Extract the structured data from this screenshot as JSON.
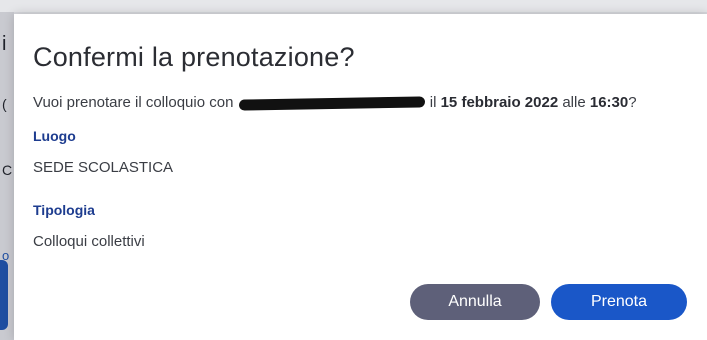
{
  "background_fragments": {
    "frag_1": "i",
    "frag_2": "(",
    "frag_3": "C",
    "frag_4": "o"
  },
  "dialog": {
    "title": "Confermi la prenotazione?",
    "question": {
      "prefix": "Vuoi prenotare il colloquio con",
      "connector": "il",
      "date": "15 febbraio 2022",
      "time_connector": "alle",
      "time": "16:30",
      "suffix": "?"
    },
    "location": {
      "label": "Luogo",
      "value": "SEDE SCOLASTICA"
    },
    "type": {
      "label": "Tipologia",
      "value": "Colloqui collettivi"
    },
    "buttons": {
      "cancel": "Annulla",
      "confirm": "Prenota"
    }
  },
  "colors": {
    "accent_blue": "#1a57c8",
    "label_blue": "#1d3c8f",
    "cancel_gray": "#5e6079"
  }
}
